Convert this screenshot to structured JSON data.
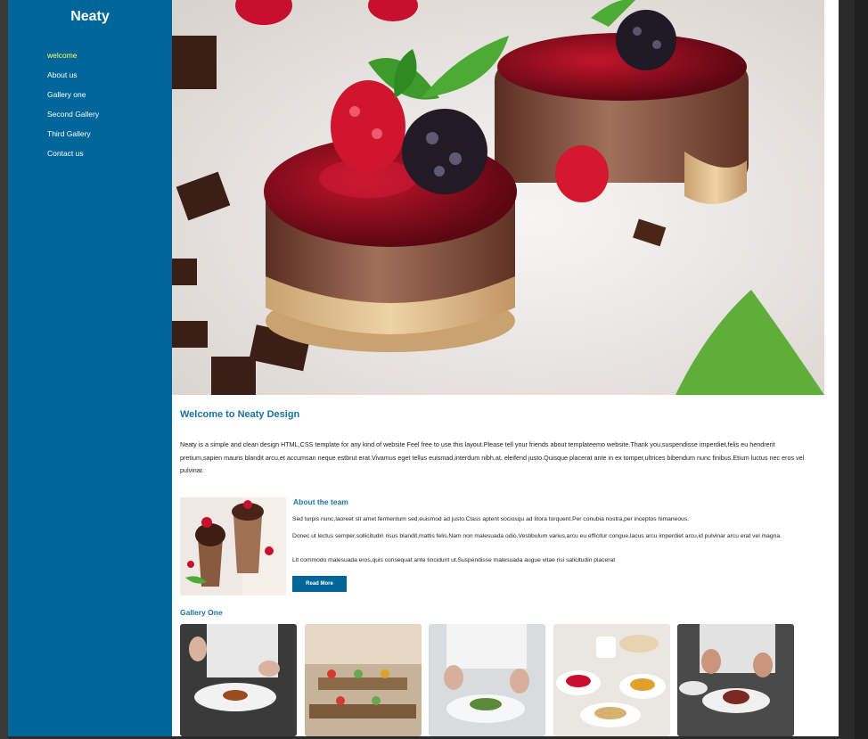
{
  "brand": "Neaty",
  "nav": [
    {
      "label": "welcome",
      "active": true
    },
    {
      "label": "About us"
    },
    {
      "label": "Gallery one"
    },
    {
      "label": "Second Gallery"
    },
    {
      "label": "Third Gallery"
    },
    {
      "label": "Contact us"
    }
  ],
  "welcome": {
    "title": "Welcome to Neaty Design",
    "body": "Neaty is a simple and clean design HTML,CSS template for any kind of website Feel free to use this layout.Please tell your friends about templateemo website.Thank you,suspendisse imperdiet,felis eu hendrerit pretium,sapien mauris blandit arcu,et accumsan neque estbrut erat.Vivamus eget tellus euismad,interdum nibh.at, eleifend justo.Quisque placerat ante in ex tomper,ultrices bibendum nunc finibus.Etium luctus nec eros vel pulvinar."
  },
  "team": {
    "title": "About the team",
    "p1": "Sed turpis nunc,laoreet sit amet fermentum sed,euismod ad justo.Class aptent sociosqu ad litora torquent.Per conubia nostra,per inceptos himaneous.",
    "p2": "Donec ut lectus semper,sollicitudin risus blandit,mattis felis.Nam non malesuada odio.Vestibulum varius,arcu eu efficitur congue,lacus arcu imperdiet arcu,id pulvinar arcu erat vel magna.",
    "p3": "Lit commodo malesuada eros,quis consequat ante tincidunt ut.Suspendisse malesuada augue vitae risi salicitudin placerat",
    "button": "Read More"
  },
  "gallery": {
    "title": "Gallery One"
  },
  "colors": {
    "sidebar": "#006699",
    "accent": "#1a73a8",
    "active_nav": "#ffff66"
  }
}
